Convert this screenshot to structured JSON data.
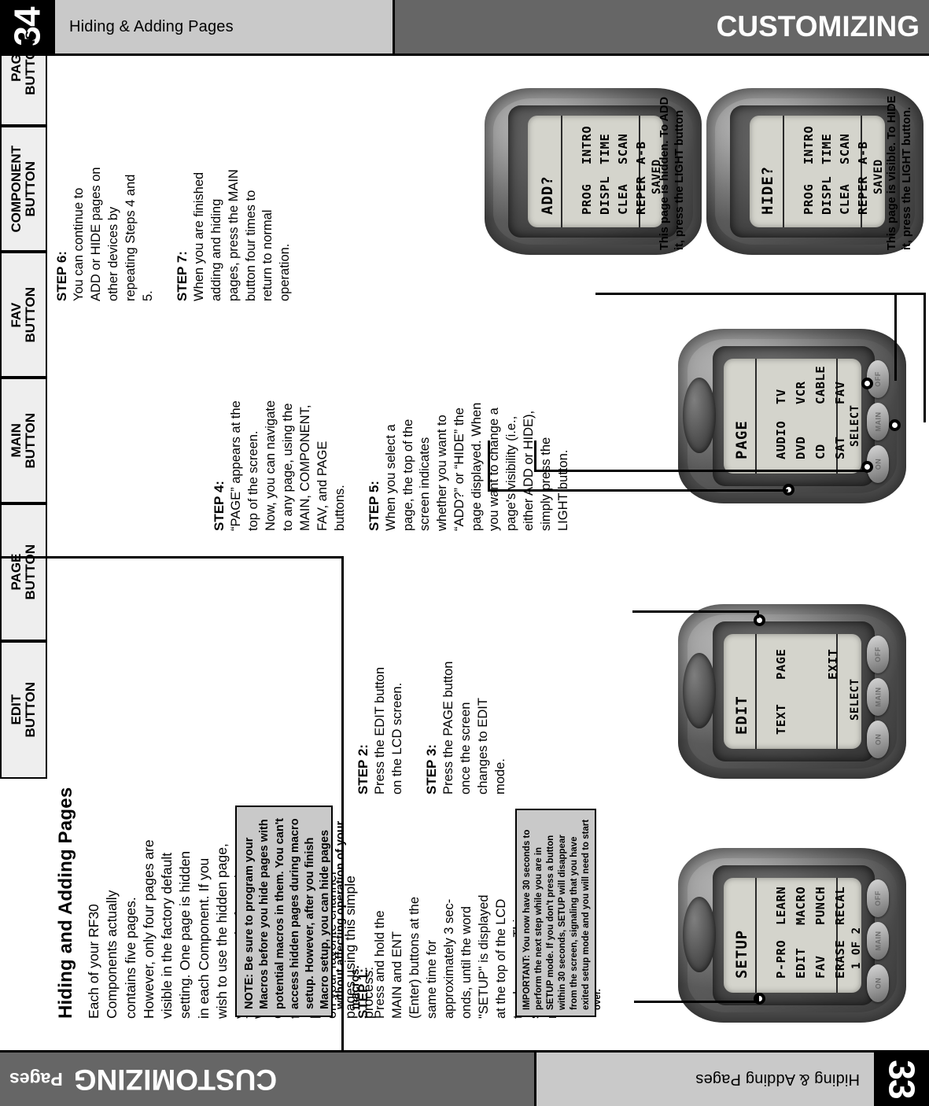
{
  "header_top": {
    "page_number": "34",
    "running_head": "Hiding & Adding Pages",
    "section_title": "CUSTOMIZING"
  },
  "header_bottom": {
    "page_number": "33",
    "running_head": "Hiding & Adding Pages",
    "section_sub": "Pages",
    "section_title": "CUSTOMIZING"
  },
  "article": {
    "heading": "Hiding and Adding Pages",
    "intro": "Each of your RF30 Components actually contains five pages. However, only four pages are visible in the factory default setting. One page is hidden in each Component. If you wish to use the hidden page, you can ADD it. If you don't want to use some of the existing pages, you can HIDE them. You can add or hide pages on Components OR on your favorite channel pages using this simple process:",
    "note": "NOTE: Be sure to program your Macros before you hide pages with potential macros in them. You can't access hidden pages during macro setup. However, after you finish Macro setup, you can hide pages without affecting operation of your macros."
  },
  "steps": [
    {
      "label": "STEP 1:",
      "text": "Press and hold the MAIN and ENT (Enter) buttons at the same time for approximately 3 sec-onds, until the word \"SETUP\" is displayed at the top of the LCD touch screen. This signals that you are now in setup mode."
    },
    {
      "label": "STEP 2:",
      "text": "Press the EDIT button on the LCD screen."
    },
    {
      "label": "STEP 3:",
      "text": "Press the PAGE button once the screen changes to EDIT mode."
    },
    {
      "label": "STEP 4:",
      "text": "“PAGE” appears at the top of the screen. Now, you can navigate to any page, using the MAIN, COMPONENT, FAV, and PAGE buttons."
    },
    {
      "label": "STEP 5:",
      "text": "When you select a page, the top of the screen indicates whether you want to “ADD?” or “HIDE” the page displayed. When you want to change a page's visibility (i.e., either ADD or HIDE), simply press the LIGHT button."
    },
    {
      "label": "STEP 6:",
      "text": "You can continue to ADD or HIDE pages on other devices by repeating Steps 4 and 5."
    },
    {
      "label": "STEP 7:",
      "text": "When you are finished adding and hiding pages, press the MAIN button four times to return to normal operation."
    }
  ],
  "important_note": "IMPORTANT: You now have 30 seconds to perform the next step while you are in SETUP mode. If you don't press a button within 30 seconds, SETUP will disappear from the screen, signaling that you have exited setup mode and you will need to start over.",
  "callouts": {
    "page_buttons": "PAGE\nBUTTONS",
    "component_button": "COMPONENT\nBUTTON",
    "fav_button": "FAV\nBUTTON",
    "main_button": "MAIN\nBUTTON",
    "page_button": "PAGE\nBUTTON",
    "edit_button": "EDIT\nBUTTON"
  },
  "captions": {
    "add_screen": "This page is hidden. To ADD it, press the LIGHT button",
    "hide_screen": "This page is visible. To HIDE it, press the LIGHT button."
  },
  "screens": {
    "add": {
      "title": "ADD?",
      "rows": [
        [
          "PROG",
          "INTRO"
        ],
        [
          "DISPL",
          "TIME"
        ],
        [
          "CLEA",
          "SCAN"
        ],
        [
          "REPER",
          "A-B"
        ]
      ],
      "soft": "SAVED"
    },
    "hide": {
      "title": "HIDE?",
      "rows": [
        [
          "PROG",
          "INTRO"
        ],
        [
          "DISPL",
          "TIME"
        ],
        [
          "CLEA",
          "SCAN"
        ],
        [
          "REPER",
          "A-B"
        ]
      ],
      "soft": "SAVED"
    },
    "page": {
      "title": "PAGE",
      "rows": [
        [
          "AUDIO",
          "TV"
        ],
        [
          "DVD",
          "VCR"
        ],
        [
          "CD",
          "CABLE"
        ],
        [
          "SAT",
          "FAV"
        ]
      ],
      "soft": "SELECT"
    },
    "edit": {
      "title": "EDIT",
      "rows": [
        [
          "TEXT",
          "PAGE"
        ],
        [
          "",
          "EXIT"
        ]
      ],
      "soft": "SELECT"
    },
    "setup": {
      "title": "SETUP",
      "rows": [
        [
          "P-PRO",
          "LEARN"
        ],
        [
          "EDIT",
          "MACRO"
        ],
        [
          "FAV",
          "PUNCH"
        ],
        [
          "ERASE",
          "RECAL"
        ]
      ],
      "soft": "1 OF 2"
    }
  },
  "device_buttons": {
    "off": "OFF",
    "main": "MAIN",
    "on": "ON"
  },
  "colors": {
    "header_gray": "#666666",
    "running_head_gray": "#c9c9c9",
    "note_gray": "#c9c9c9",
    "callout_gray": "#eeeeee",
    "black": "#000000"
  }
}
